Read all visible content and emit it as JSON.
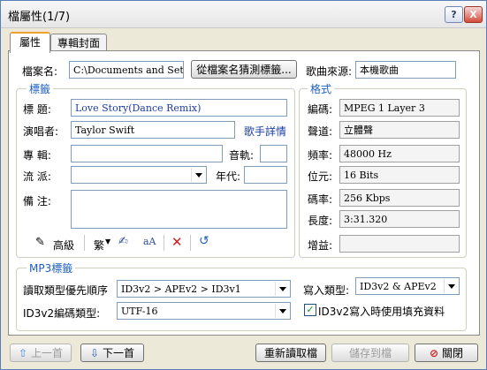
{
  "window": {
    "title": "檔屬性(1/7)",
    "help_btn": "?",
    "close_btn": "X"
  },
  "tabs": [
    {
      "label": "屬性"
    },
    {
      "label": "專輯封面"
    }
  ],
  "file": {
    "name_label": "檔案名:",
    "name_value": "C:\\Documents and Settings\\",
    "guess_button": "從檔案名猜測標籤...",
    "source_label": "歌曲來源:",
    "source_value": "本機歌曲"
  },
  "tags": {
    "group_label": "標籤",
    "title_label": "標  題:",
    "title_value": "Love Story(Dance Remix)",
    "artist_label": "演唱者:",
    "artist_value": "Taylor Swift",
    "artist_link": "歌手詳情",
    "album_label": "專  輯:",
    "album_value": "",
    "track_label": "音軌:",
    "track_value": "",
    "genre_label": "流  派:",
    "genre_value": "",
    "year_label": "年代:",
    "year_value": "",
    "comment_label": "備  注:",
    "comment_value": "",
    "advanced_label": "高級",
    "trad_label": "繁"
  },
  "format": {
    "group_label": "格式",
    "encoding_label": "編碼:",
    "encoding_value": "MPEG 1 Layer 3",
    "channel_label": "聲道:",
    "channel_value": "立體聲",
    "freq_label": "頻率:",
    "freq_value": "48000 Hz",
    "bits_label": "位元:",
    "bits_value": "16 Bits",
    "bitrate_label": "碼率:",
    "bitrate_value": "256 Kbps",
    "length_label": "長度:",
    "length_value": "3:31.320",
    "gain_label": "增益:",
    "gain_value": ""
  },
  "mp3": {
    "group_label": "MP3標籤",
    "read_order_label": "讀取類型優先順序",
    "read_order_value": "ID3v2 > APEv2 > ID3v1",
    "write_type_label": "寫入類型:",
    "write_type_value": "ID3v2 & APEv2",
    "encoding_label": "ID3v2編碼類型:",
    "encoding_value": "UTF-16",
    "padding_label": "ID3v2寫入時使用填充資料",
    "padding_checked": true
  },
  "footer": {
    "prev_label": "上一首",
    "next_label": "下一首",
    "reload_label": "重新讀取檔",
    "save_label": "儲存到檔",
    "close_label": "關閉"
  }
}
